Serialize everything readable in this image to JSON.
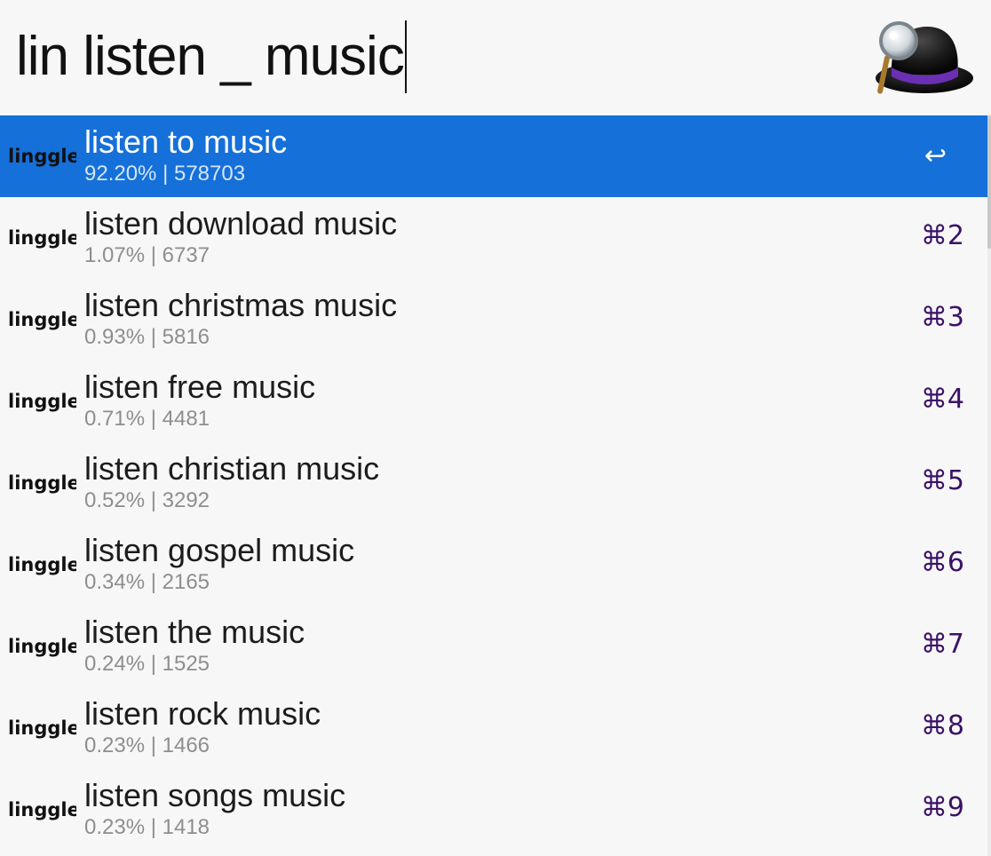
{
  "search": {
    "query": "lin listen _ music"
  },
  "logo": {
    "icon": "alfred-hat-magnifier-icon"
  },
  "result_icon_text": "linggle",
  "colors": {
    "selection": "#1570d9",
    "shortcut": "#3a1266",
    "hat_band": "#6b2fb3"
  },
  "results": [
    {
      "title": "listen to music",
      "subtitle": "92.20% | 578703",
      "shortcut": "↩",
      "selected": true
    },
    {
      "title": "listen download music",
      "subtitle": "1.07% | 6737",
      "shortcut": "⌘2"
    },
    {
      "title": "listen christmas music",
      "subtitle": "0.93% | 5816",
      "shortcut": "⌘3"
    },
    {
      "title": "listen free music",
      "subtitle": "0.71% | 4481",
      "shortcut": "⌘4"
    },
    {
      "title": "listen christian music",
      "subtitle": "0.52% | 3292",
      "shortcut": "⌘5"
    },
    {
      "title": "listen gospel music",
      "subtitle": "0.34% | 2165",
      "shortcut": "⌘6"
    },
    {
      "title": "listen the music",
      "subtitle": "0.24% | 1525",
      "shortcut": "⌘7"
    },
    {
      "title": "listen rock music",
      "subtitle": "0.23% | 1466",
      "shortcut": "⌘8"
    },
    {
      "title": "listen songs music",
      "subtitle": "0.23% | 1418",
      "shortcut": "⌘9"
    }
  ]
}
